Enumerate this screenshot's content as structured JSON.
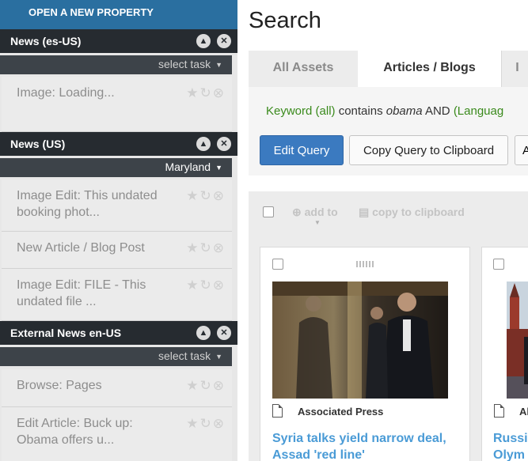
{
  "sidebar": {
    "open_property": "OPEN A NEW PROPERTY",
    "sections": [
      {
        "title": "News (es-US)",
        "task_select": "select task",
        "tasks": [
          {
            "label": "Image: Loading..."
          }
        ]
      },
      {
        "title": "News (US)",
        "task_select": "Maryland",
        "tasks": [
          {
            "label": "Image Edit: This undated booking phot..."
          },
          {
            "label": "New Article / Blog Post"
          },
          {
            "label": "Image Edit: FILE - This undated file ..."
          }
        ]
      },
      {
        "title": "External News en-US",
        "task_select": "select task",
        "tasks": [
          {
            "label": "Browse: Pages"
          },
          {
            "label": "Edit Article: Buck up: Obama offers u..."
          }
        ]
      }
    ],
    "icons": {
      "collapse": "chevron-up-icon",
      "close": "close-icon",
      "star": "star-icon",
      "refresh": "refresh-icon",
      "remove": "remove-icon",
      "caret": "caret-down-icon"
    }
  },
  "main": {
    "title": "Search",
    "tabs": [
      {
        "label": "All Assets",
        "active": false
      },
      {
        "label": "Articles / Blogs",
        "active": true
      },
      {
        "label": "I",
        "active": false
      }
    ],
    "query": {
      "keyword": "Keyword (all)",
      "op": "contains",
      "term": "obama",
      "and": "AND",
      "lang": "(Languag"
    },
    "buttons": {
      "edit_query": "Edit Query",
      "copy_query": "Copy Query to Clipboard",
      "more": "A"
    },
    "toolbar": {
      "add_to": "add to",
      "copy_clip": "copy to clipboard"
    },
    "cards": [
      {
        "source": "Associated Press",
        "headline_l1": "Syria talks yield narrow deal,",
        "headline_l2": "Assad 'red line'"
      },
      {
        "source": "Al",
        "headline_l1": "Russi",
        "headline_l2": "Olym"
      }
    ]
  },
  "colors": {
    "open_property_bg": "#2a6fa0",
    "section_header_bg": "#262b30",
    "task_bar_bg": "#3d4349",
    "primary_button": "#3b7ac0",
    "query_green": "#3a8a1c",
    "link_blue": "#4a9bd6"
  }
}
